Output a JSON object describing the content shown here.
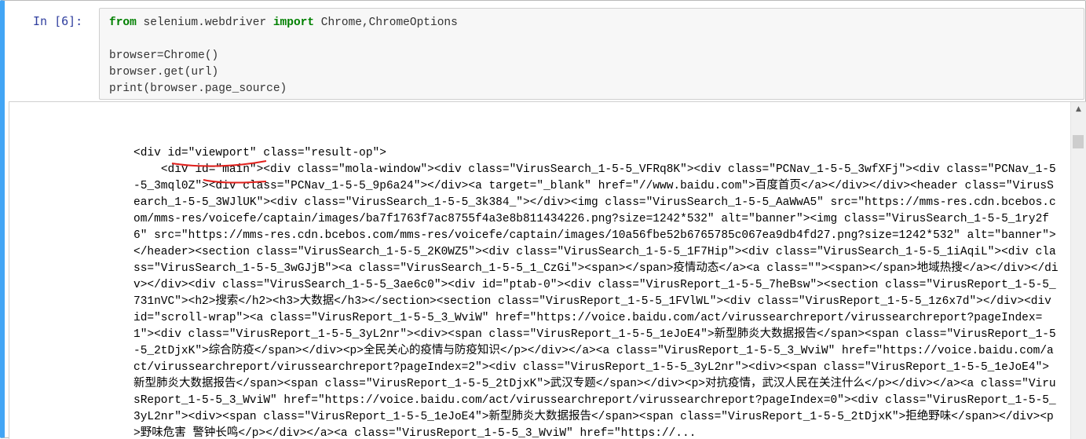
{
  "cell": {
    "prompt": "In  [6]:",
    "code": {
      "line1": {
        "kw_from": "from",
        "module": " selenium.webdriver ",
        "kw_import": "import",
        "names": " Chrome,ChromeOptions"
      },
      "line2": "browser=Chrome()",
      "line3": "browser.get(url)",
      "line4": "print(browser.page_source)"
    }
  },
  "output": {
    "line_indent": "<div id=\"viewport\" class=\"result-op\">",
    "body": "    <div id=\"main\"><div class=\"mola-window\"><div class=\"VirusSearch_1-5-5_VFRq8K\"><div class=\"PCNav_1-5-5_3wfXFj\"><div class=\"PCNav_1-5-5_3mql0Z\"><div class=\"PCNav_1-5-5_9p6a24\"></div><a target=\"_blank\" href=\"//www.baidu.com\">百度首页</a></div></div><header class=\"VirusSearch_1-5-5_3WJlUK\"><div class=\"VirusSearch_1-5-5_3k384_\"></div><img class=\"VirusSearch_1-5-5_AaWwA5\" src=\"https://mms-res.cdn.bcebos.com/mms-res/voicefe/captain/images/ba7f1763f7ac8755f4a3e8b811434226.png?size=1242*532\" alt=\"banner\"><img class=\"VirusSearch_1-5-5_1ry2f6\" src=\"https://mms-res.cdn.bcebos.com/mms-res/voicefe/captain/images/10a56fbe52b6765785c067ea9db4fd27.png?size=1242*532\" alt=\"banner\"></header><section class=\"VirusSearch_1-5-5_2K0WZ5\"><div class=\"VirusSearch_1-5-5_1F7Hip\"><div class=\"VirusSearch_1-5-5_1iAqiL\"><div class=\"VirusSearch_1-5-5_3wGJjB\"><a class=\"VirusSearch_1-5-5_1_CzGi\"><span></span>疫情动态</a><a class=\"\"><span></span>地域热搜</a></div></div></div><div class=\"VirusSearch_1-5-5_3ae6c0\"><div id=\"ptab-0\"><div class=\"VirusReport_1-5-5_7heBsw\"><section class=\"VirusReport_1-5-5_731nVC\"><h2>搜索</h2><h3>大数据</h3></section><section class=\"VirusReport_1-5-5_1FVlWL\"><div class=\"VirusReport_1-5-5_1z6x7d\"></div><div id=\"scroll-wrap\"><a class=\"VirusReport_1-5-5_3_WviW\" href=\"https://voice.baidu.com/act/virussearchreport/virussearchreport?pageIndex=1\"><div class=\"VirusReport_1-5-5_3yL2nr\"><div><span class=\"VirusReport_1-5-5_1eJoE4\">新型肺炎大数据报告</span><span class=\"VirusReport_1-5-5_2tDjxK\">综合防疫</span></div><p>全民关心的疫情与防疫知识</p></div></a><a class=\"VirusReport_1-5-5_3_WviW\" href=\"https://voice.baidu.com/act/virussearchreport/virussearchreport?pageIndex=2\"><div class=\"VirusReport_1-5-5_3yL2nr\"><div><span class=\"VirusReport_1-5-5_1eJoE4\">新型肺炎大数据报告</span><span class=\"VirusReport_1-5-5_2tDjxK\">武汉专题</span></div><p>对抗疫情，武汉人民在关注什么</p></div></a><a class=\"VirusReport_1-5-5_3_WviW\" href=\"https://voice.baidu.com/act/virussearchreport/virussearchreport?pageIndex=0\"><div class=\"VirusReport_1-5-5_3yL2nr\"><div><span class=\"VirusReport_1-5-5_1eJoE4\">新型肺炎大数据报告</span><span class=\"VirusReport_1-5-5_2tDjxK\">拒绝野味</span></div><p>野味危害 警钟长鸣</p></div></a><a class=\"VirusReport_1-5-5_3_WviW\" href=\"https://..."
  },
  "annotation": {
    "color": "#e0201c"
  },
  "scrollbar": {
    "up_icon": "triangle-up"
  }
}
